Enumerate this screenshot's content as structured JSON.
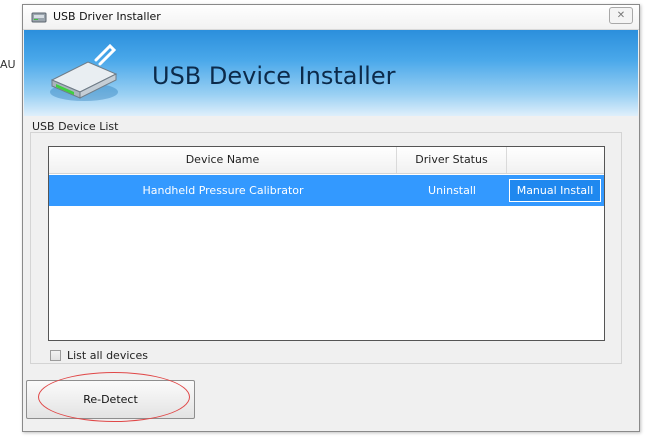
{
  "background": {
    "edge_text": "AU"
  },
  "window": {
    "title": "USB Driver Installer",
    "close_glyph": "✕"
  },
  "header": {
    "title": "USB Device Installer"
  },
  "device_list": {
    "group_label": "USB Device List",
    "columns": [
      "Device Name",
      "Driver Status",
      ""
    ],
    "rows": [
      {
        "device_name": "Handheld Pressure Calibrator",
        "driver_status": "Uninstall",
        "action_label": "Manual Install",
        "selected": true
      }
    ]
  },
  "list_all_devices": {
    "label": "List all devices",
    "checked": false
  },
  "redetect_button": {
    "label": "Re-Detect"
  },
  "colors": {
    "selection": "#3399ff",
    "header_gradient_top": "#2b8fdc",
    "annotation_ellipse": "#e04848"
  },
  "icons": {
    "app": "usb-drive-icon",
    "header": "usb-drive-large-icon",
    "close": "close-icon"
  }
}
